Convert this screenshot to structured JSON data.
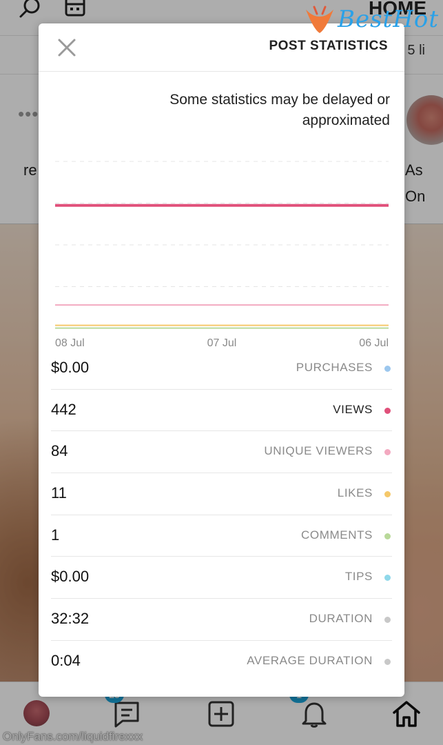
{
  "background": {
    "header_title": "HOME",
    "subheader_text": "5 li",
    "post_text_left": "re",
    "post_text_right_1": "As",
    "post_text_right_2": "On",
    "nav": {
      "messages_badge": "25",
      "notifications_badge": "1"
    },
    "watermark_url": "OnlyFans.com/liquidfirexxx",
    "watermark_logo_text": "BestHot"
  },
  "modal": {
    "title": "POST STATISTICS",
    "note": "Some statistics may be delayed or approximated"
  },
  "chart_data": {
    "type": "line",
    "x": [
      "06 Jul",
      "07 Jul",
      "08 Jul"
    ],
    "xlabel": "",
    "ylabel": "",
    "grid": true,
    "legend": "none",
    "series": [
      {
        "values": [
          442,
          442,
          442
        ],
        "color": "#e0507a"
      },
      {
        "values": [
          84,
          84,
          84
        ],
        "color": "#f3a9c0"
      },
      {
        "values": [
          11,
          11,
          11
        ],
        "color": "#f5c86a"
      },
      {
        "values": [
          1,
          1,
          1
        ],
        "color": "#b9d99a"
      }
    ],
    "ylim": [
      0,
      600
    ]
  },
  "stats": [
    {
      "label": "PURCHASES",
      "value": "$0.00",
      "color": "#9cc7ee",
      "emphasis": false
    },
    {
      "label": "VIEWS",
      "value": "442",
      "color": "#e0507a",
      "emphasis": true
    },
    {
      "label": "UNIQUE VIEWERS",
      "value": "84",
      "color": "#f3a9c0",
      "emphasis": false
    },
    {
      "label": "LIKES",
      "value": "11",
      "color": "#f5c86a",
      "emphasis": false
    },
    {
      "label": "COMMENTS",
      "value": "1",
      "color": "#b9d99a",
      "emphasis": false
    },
    {
      "label": "TIPS",
      "value": "$0.00",
      "color": "#8fd8ea",
      "emphasis": false
    },
    {
      "label": "DURATION",
      "value": "32:32",
      "color": "#c8c8c8",
      "emphasis": false
    },
    {
      "label": "AVERAGE DURATION",
      "value": "0:04",
      "color": "#c8c8c8",
      "emphasis": false
    }
  ]
}
